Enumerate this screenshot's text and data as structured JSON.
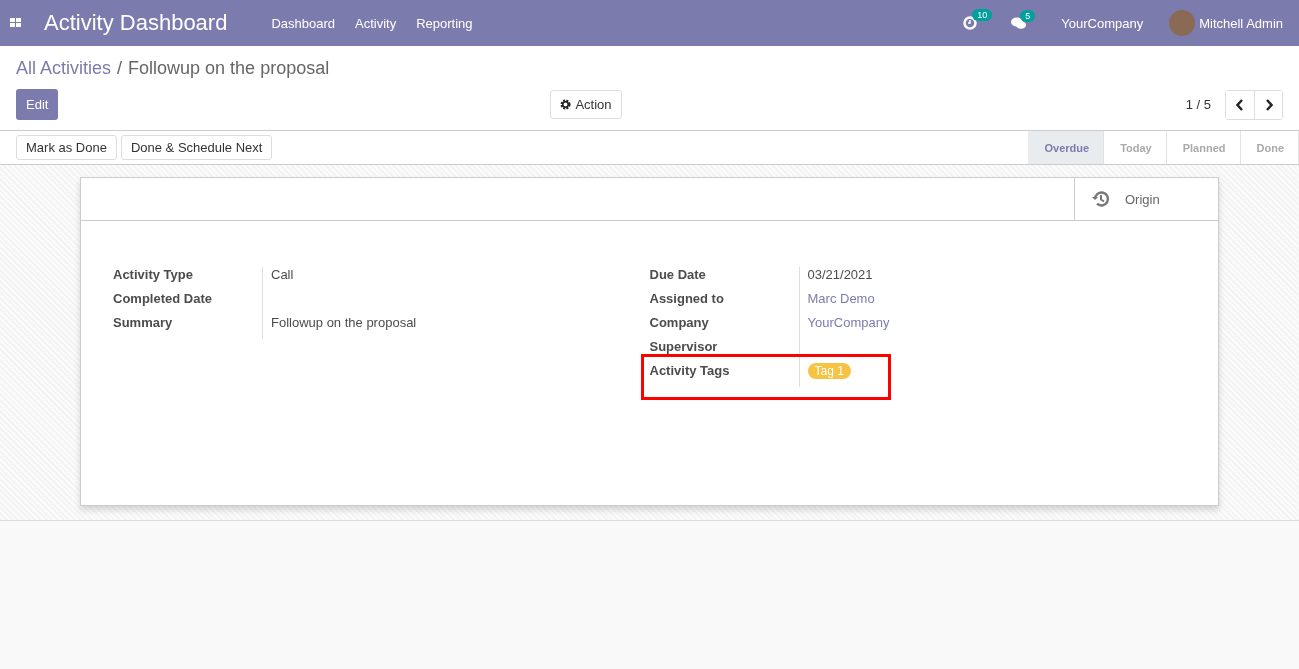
{
  "navbar": {
    "app_title": "Activity Dashboard",
    "menu": [
      "Dashboard",
      "Activity",
      "Reporting"
    ],
    "activity_count": "10",
    "message_count": "5",
    "company": "YourCompany",
    "user": "Mitchell Admin"
  },
  "breadcrumb": {
    "parent": "All Activities",
    "separator": "/",
    "current": "Followup on the proposal"
  },
  "control_panel": {
    "edit": "Edit",
    "action": "Action",
    "pager": "1 / 5"
  },
  "statusbar": {
    "buttons": [
      "Mark as Done",
      "Done & Schedule Next"
    ],
    "stages": [
      {
        "label": "Overdue",
        "selected": true
      },
      {
        "label": "Today",
        "selected": false
      },
      {
        "label": "Planned",
        "selected": false
      },
      {
        "label": "Done",
        "selected": false
      }
    ]
  },
  "form": {
    "smart_button": "Origin",
    "left_fields": [
      {
        "label": "Activity Type",
        "value": "Call"
      },
      {
        "label": "Completed Date"
      },
      {
        "label": "Summary",
        "value": "Followup on the proposal"
      }
    ],
    "right_fields": [
      {
        "label": "Due Date",
        "value": "03/21/2021",
        "kind": "text"
      },
      {
        "label": "Assigned to",
        "value": "Marc Demo",
        "kind": "link"
      },
      {
        "label": "Company",
        "value": "YourCompany",
        "kind": "link"
      },
      {
        "label": "Supervisor",
        "kind": "text"
      },
      {
        "label": "Activity Tags",
        "value": "Tag 1",
        "kind": "tag",
        "color": "#f6c342"
      }
    ]
  }
}
